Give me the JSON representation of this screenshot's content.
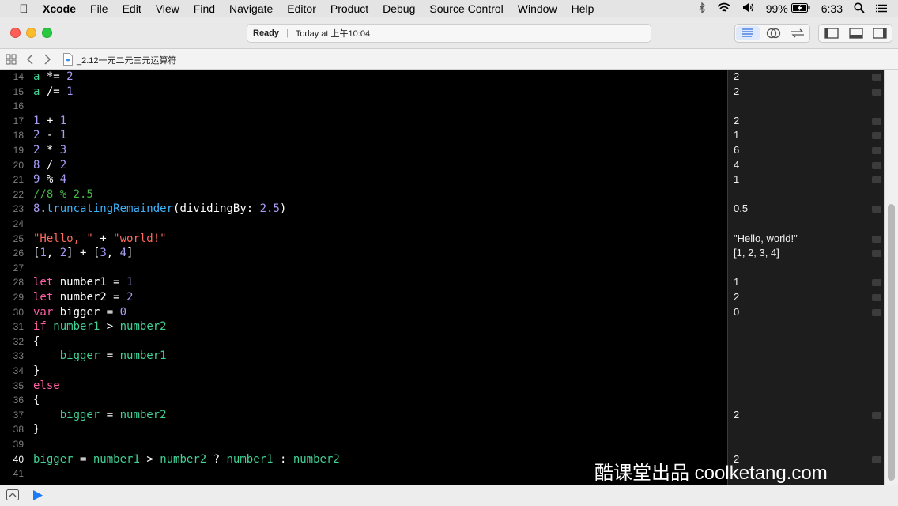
{
  "menubar": {
    "app_name": "Xcode",
    "items": [
      "File",
      "Edit",
      "View",
      "Find",
      "Navigate",
      "Editor",
      "Product",
      "Debug",
      "Source Control",
      "Window",
      "Help"
    ],
    "battery": "99%",
    "time": "6:33",
    "icons": [
      "apple-icon",
      "bluetooth-icon",
      "wifi-icon",
      "volume-icon",
      "battery-icon",
      "search-icon"
    ]
  },
  "toolbar": {
    "status_label": "Ready",
    "status_time": "Today at 上午10:04",
    "editor_modes": [
      "standard-editor-icon",
      "assistant-editor-icon",
      "version-editor-icon"
    ],
    "panels": [
      "navigator-panel-icon",
      "debug-area-icon",
      "utilities-panel-icon"
    ]
  },
  "jumpbar": {
    "file_name": "_2.12一元二元三元运算符"
  },
  "colors": {
    "keyword": "#fc5fa3",
    "number": "#a79df7",
    "comment": "#41b645",
    "string": "#fc6a5d",
    "identifier": "#41d195",
    "function": "#3fb5fc",
    "plain": "#ffffff"
  },
  "editor": {
    "current_line": "40",
    "lines": [
      {
        "num": "14",
        "tokens": [
          [
            "a",
            "identifier"
          ],
          [
            " *= ",
            "plain"
          ],
          [
            "2",
            "number"
          ]
        ],
        "result": "2"
      },
      {
        "num": "15",
        "tokens": [
          [
            "a",
            "identifier"
          ],
          [
            " /= ",
            "plain"
          ],
          [
            "1",
            "number"
          ]
        ],
        "result": "2"
      },
      {
        "num": "16",
        "tokens": [],
        "result": ""
      },
      {
        "num": "17",
        "tokens": [
          [
            "1",
            "number"
          ],
          [
            " + ",
            "plain"
          ],
          [
            "1",
            "number"
          ]
        ],
        "result": "2"
      },
      {
        "num": "18",
        "tokens": [
          [
            "2",
            "number"
          ],
          [
            " - ",
            "plain"
          ],
          [
            "1",
            "number"
          ]
        ],
        "result": "1"
      },
      {
        "num": "19",
        "tokens": [
          [
            "2",
            "number"
          ],
          [
            " * ",
            "plain"
          ],
          [
            "3",
            "number"
          ]
        ],
        "result": "6"
      },
      {
        "num": "20",
        "tokens": [
          [
            "8",
            "number"
          ],
          [
            " / ",
            "plain"
          ],
          [
            "2",
            "number"
          ]
        ],
        "result": "4"
      },
      {
        "num": "21",
        "tokens": [
          [
            "9",
            "number"
          ],
          [
            " % ",
            "plain"
          ],
          [
            "4",
            "number"
          ]
        ],
        "result": "1"
      },
      {
        "num": "22",
        "tokens": [
          [
            "//8 % 2.5",
            "comment"
          ]
        ],
        "result": ""
      },
      {
        "num": "23",
        "tokens": [
          [
            "8",
            "number"
          ],
          [
            ".",
            "plain"
          ],
          [
            "truncatingRemainder",
            "function"
          ],
          [
            "(dividingBy: ",
            "plain"
          ],
          [
            "2.5",
            "number"
          ],
          [
            ")",
            "plain"
          ]
        ],
        "result": "0.5"
      },
      {
        "num": "24",
        "tokens": [],
        "result": ""
      },
      {
        "num": "25",
        "tokens": [
          [
            "\"Hello, \"",
            "string"
          ],
          [
            " + ",
            "plain"
          ],
          [
            "\"world!\"",
            "string"
          ]
        ],
        "result": "\"Hello, world!\""
      },
      {
        "num": "26",
        "tokens": [
          [
            "[",
            "plain"
          ],
          [
            "1",
            "number"
          ],
          [
            ", ",
            "plain"
          ],
          [
            "2",
            "number"
          ],
          [
            "] + [",
            "plain"
          ],
          [
            "3",
            "number"
          ],
          [
            ", ",
            "plain"
          ],
          [
            "4",
            "number"
          ],
          [
            "]",
            "plain"
          ]
        ],
        "result": "[1, 2, 3, 4]"
      },
      {
        "num": "27",
        "tokens": [],
        "result": ""
      },
      {
        "num": "28",
        "tokens": [
          [
            "let",
            "keyword"
          ],
          [
            " number1 = ",
            "plain"
          ],
          [
            "1",
            "number"
          ]
        ],
        "result": "1"
      },
      {
        "num": "29",
        "tokens": [
          [
            "let",
            "keyword"
          ],
          [
            " number2 = ",
            "plain"
          ],
          [
            "2",
            "number"
          ]
        ],
        "result": "2"
      },
      {
        "num": "30",
        "tokens": [
          [
            "var",
            "keyword"
          ],
          [
            " bigger = ",
            "plain"
          ],
          [
            "0",
            "number"
          ]
        ],
        "result": "0"
      },
      {
        "num": "31",
        "tokens": [
          [
            "if",
            "keyword"
          ],
          [
            " ",
            "plain"
          ],
          [
            "number1",
            "identifier"
          ],
          [
            " > ",
            "plain"
          ],
          [
            "number2",
            "identifier"
          ]
        ],
        "result": ""
      },
      {
        "num": "32",
        "tokens": [
          [
            "{",
            "plain"
          ]
        ],
        "result": ""
      },
      {
        "num": "33",
        "tokens": [
          [
            "    ",
            "plain"
          ],
          [
            "bigger",
            "identifier"
          ],
          [
            " = ",
            "plain"
          ],
          [
            "number1",
            "identifier"
          ]
        ],
        "result": ""
      },
      {
        "num": "34",
        "tokens": [
          [
            "}",
            "plain"
          ]
        ],
        "result": ""
      },
      {
        "num": "35",
        "tokens": [
          [
            "else",
            "keyword"
          ]
        ],
        "result": ""
      },
      {
        "num": "36",
        "tokens": [
          [
            "{",
            "plain"
          ]
        ],
        "result": ""
      },
      {
        "num": "37",
        "tokens": [
          [
            "    ",
            "plain"
          ],
          [
            "bigger",
            "identifier"
          ],
          [
            " = ",
            "plain"
          ],
          [
            "number2",
            "identifier"
          ]
        ],
        "result": "2"
      },
      {
        "num": "38",
        "tokens": [
          [
            "}",
            "plain"
          ]
        ],
        "result": ""
      },
      {
        "num": "39",
        "tokens": [],
        "result": ""
      },
      {
        "num": "40",
        "tokens": [
          [
            "bigger",
            "identifier"
          ],
          [
            " = ",
            "plain"
          ],
          [
            "number1",
            "identifier"
          ],
          [
            " > ",
            "plain"
          ],
          [
            "number2",
            "identifier"
          ],
          [
            " ? ",
            "plain"
          ],
          [
            "number1",
            "identifier"
          ],
          [
            " : ",
            "plain"
          ],
          [
            "number2",
            "identifier"
          ]
        ],
        "result": "2"
      },
      {
        "num": "41",
        "tokens": [],
        "result": ""
      }
    ]
  },
  "watermark": "酷课堂出品 coolketang.com"
}
